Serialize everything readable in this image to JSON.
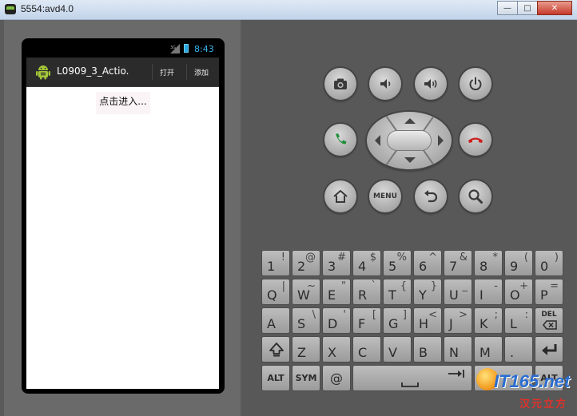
{
  "window": {
    "title": "5554:avd4.0",
    "minimize_glyph": "—",
    "maximize_glyph": "□",
    "close_glyph": "✕"
  },
  "status_bar": {
    "network_label": "3G",
    "time": "8:43"
  },
  "action_bar": {
    "title": "L0909_3_Actio.",
    "actions": [
      "打开",
      "添加"
    ]
  },
  "content": {
    "button_label": "点击进入..."
  },
  "hardware_buttons": {
    "menu_label": "MENU"
  },
  "keyboard": {
    "row1": [
      {
        "p": "1",
        "s": "!"
      },
      {
        "p": "2",
        "s": "@"
      },
      {
        "p": "3",
        "s": "#"
      },
      {
        "p": "4",
        "s": "$"
      },
      {
        "p": "5",
        "s": "%"
      },
      {
        "p": "6",
        "s": "^"
      },
      {
        "p": "7",
        "s": "&"
      },
      {
        "p": "8",
        "s": "*"
      },
      {
        "p": "9",
        "s": "("
      },
      {
        "p": "0",
        "s": ")"
      }
    ],
    "row2": [
      {
        "p": "Q",
        "s": "|"
      },
      {
        "p": "W",
        "s": "~"
      },
      {
        "p": "E",
        "s": "\""
      },
      {
        "p": "R",
        "s": "`"
      },
      {
        "p": "T",
        "s": "{"
      },
      {
        "p": "Y",
        "s": "}"
      },
      {
        "p": "U",
        "s": "_"
      },
      {
        "p": "I",
        "s": "-"
      },
      {
        "p": "O",
        "s": "+"
      },
      {
        "p": "P",
        "s": "="
      }
    ],
    "row3": [
      {
        "p": "A",
        "s": ""
      },
      {
        "p": "S",
        "s": "\\"
      },
      {
        "p": "D",
        "s": "'"
      },
      {
        "p": "F",
        "s": "["
      },
      {
        "p": "G",
        "s": "]"
      },
      {
        "p": "H",
        "s": "<"
      },
      {
        "p": "J",
        "s": ">"
      },
      {
        "p": "K",
        "s": ";"
      },
      {
        "p": "L",
        "s": ":"
      }
    ],
    "row4": [
      {
        "p": "Z",
        "s": ""
      },
      {
        "p": "X",
        "s": ""
      },
      {
        "p": "C",
        "s": ""
      },
      {
        "p": "V",
        "s": ""
      },
      {
        "p": "B",
        "s": ""
      },
      {
        "p": "N",
        "s": ""
      },
      {
        "p": "M",
        "s": ""
      },
      {
        "p": ".",
        "s": ""
      }
    ],
    "del_label": "DEL",
    "alt_label": "ALT",
    "sym_label": "SYM",
    "at_label": "@",
    "alt_right_label": "ALT"
  },
  "watermark": {
    "brand": "IT165.net",
    "subtitle": "汉元立方"
  },
  "colors": {
    "status_time": "#39b4ec",
    "call_green": "#1f8f3a",
    "end_red": "#cc2020"
  }
}
